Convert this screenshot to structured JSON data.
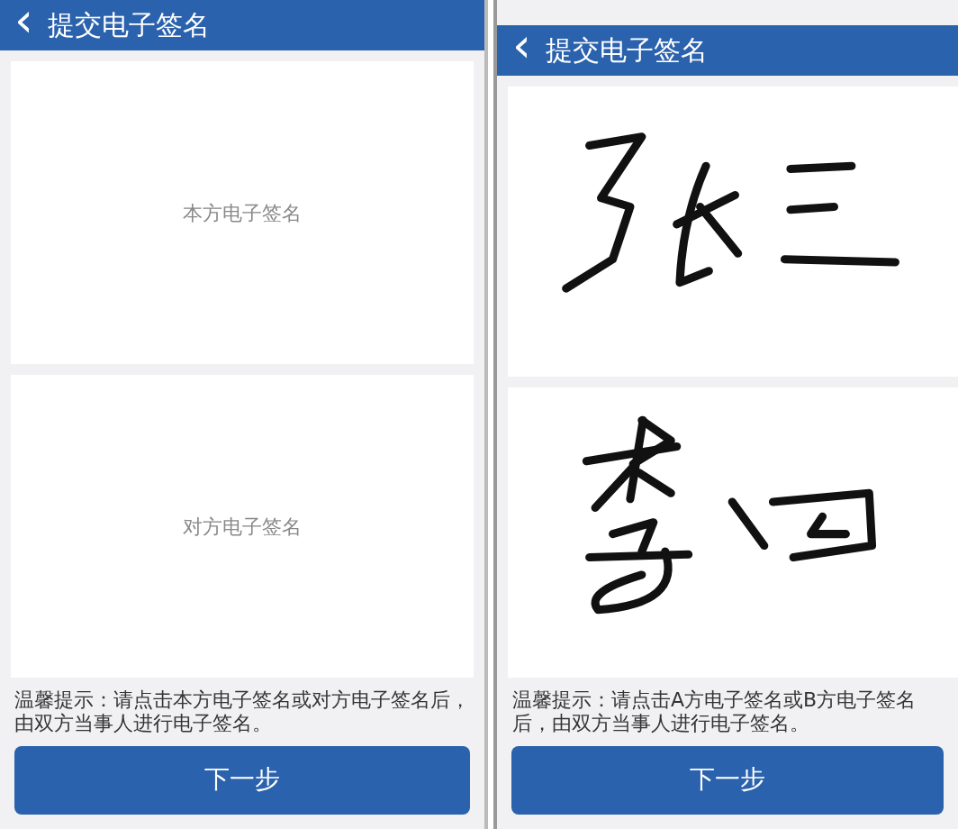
{
  "screens": [
    {
      "title": "提交电子签名",
      "back": "‹",
      "pads": [
        {
          "kind": "empty",
          "label": "本方电子签名"
        },
        {
          "kind": "empty",
          "label": "对方电子签名"
        }
      ],
      "hint": "温馨提示：请点击本方电子签名或对方电子签名后，由双方当事人进行电子签名。",
      "button": "下一步"
    },
    {
      "title": "提交电子签名",
      "back": "‹",
      "pads": [
        {
          "kind": "signed"
        },
        {
          "kind": "signed"
        }
      ],
      "hint": "温馨提示：请点击A方电子签名或B方电子签名后，由双方当事人进行电子签名。",
      "button": "下一步"
    }
  ]
}
